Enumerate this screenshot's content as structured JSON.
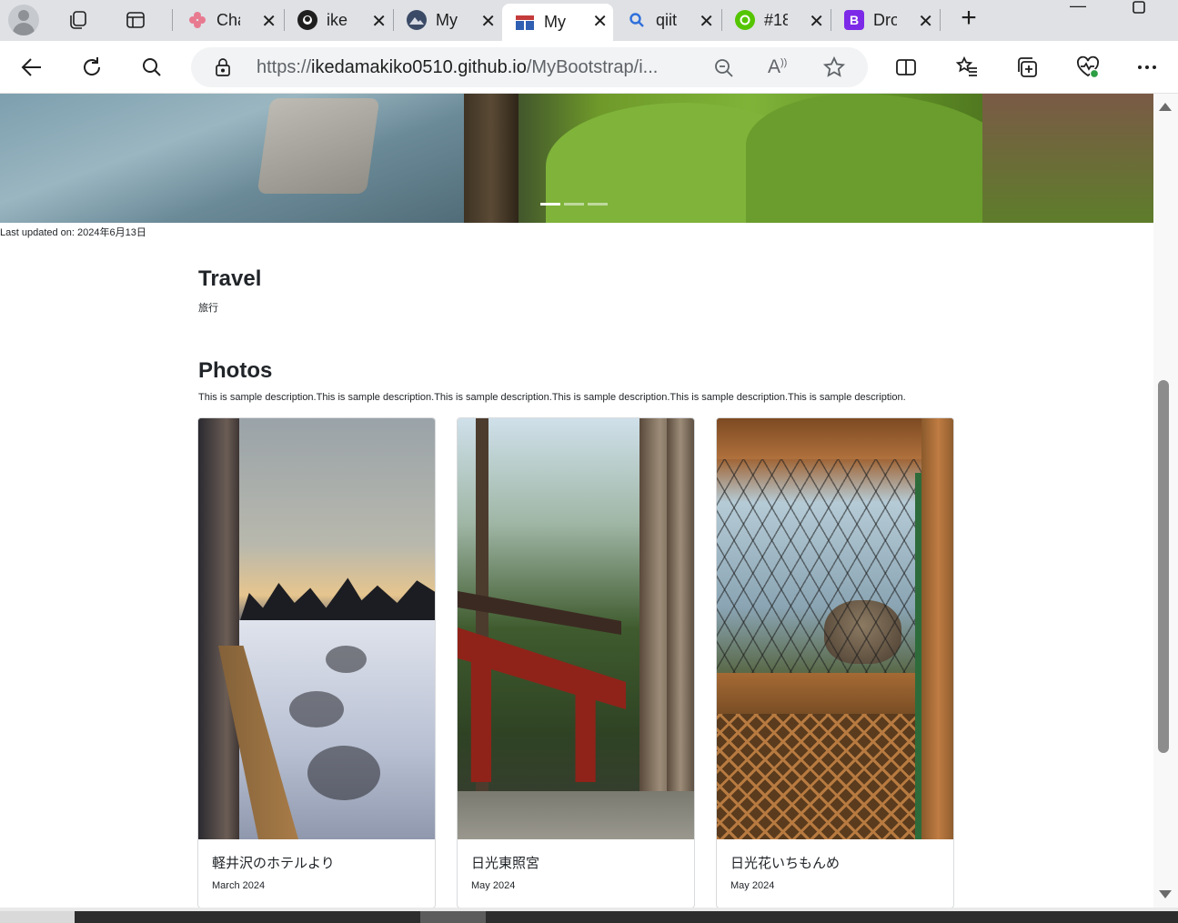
{
  "browser": {
    "tabs": [
      {
        "title": "Cha",
        "favicon": "chatgpt-flower-icon",
        "color": "#e87a90"
      },
      {
        "title": "ike",
        "favicon": "github-icon",
        "color": "#1f1f1f"
      },
      {
        "title": "My",
        "favicon": "mountain-photo-icon",
        "color": "#3b4a66"
      },
      {
        "title": "My",
        "favicon": "site-icon",
        "color": "#c43b3b",
        "active": true
      },
      {
        "title": "qiit",
        "favicon": "search-icon",
        "color": "#2f6fdb"
      },
      {
        "title": "#18",
        "favicon": "q-icon",
        "color": "#55c500"
      },
      {
        "title": "Dro",
        "favicon": "bootstrap-icon",
        "color": "#7c2ae8",
        "letter": "B"
      }
    ],
    "address": {
      "protocol": "https://",
      "domain": "ikedamakiko0510.github.io",
      "path": "/MyBootstrap/i..."
    }
  },
  "page": {
    "last_updated": "Last updated on: 2024年6月13日",
    "travel": {
      "title": "Travel",
      "subtitle": "旅行"
    },
    "photos": {
      "title": "Photos",
      "description": "This is sample description.This is sample description.This is sample description.This is sample description.This is sample description.This is sample description.",
      "cards": [
        {
          "title": "軽井沢のホテルより",
          "date": "March 2024"
        },
        {
          "title": "日光東照宮",
          "date": "May 2024"
        },
        {
          "title": "日光花いちもんめ",
          "date": "May 2024"
        }
      ]
    }
  },
  "colors": {
    "accent": "#212529",
    "tabstrip": "#dfe1e5"
  }
}
